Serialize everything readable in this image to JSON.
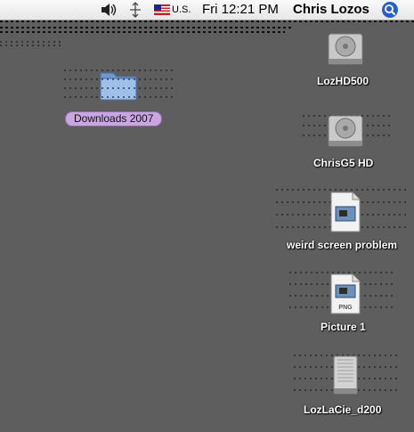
{
  "menubar": {
    "input_source": "U.S.",
    "clock": "Fri 12:21 PM",
    "user": "Chris Lozos"
  },
  "desktop": {
    "items": [
      {
        "label": "Downloads 2007",
        "kind": "folder",
        "selected": true
      },
      {
        "label": "LozHD500",
        "kind": "hard-drive"
      },
      {
        "label": "ChrisG5 HD",
        "kind": "hard-drive"
      },
      {
        "label": "weird screen problem",
        "kind": "image-file"
      },
      {
        "label": "Picture 1",
        "kind": "png-file",
        "badge": "PNG"
      },
      {
        "label": "LozLaCie_d200",
        "kind": "external-drive"
      }
    ]
  },
  "colors": {
    "desktop": "#5e5e5e",
    "selection": "#c9a6df"
  }
}
